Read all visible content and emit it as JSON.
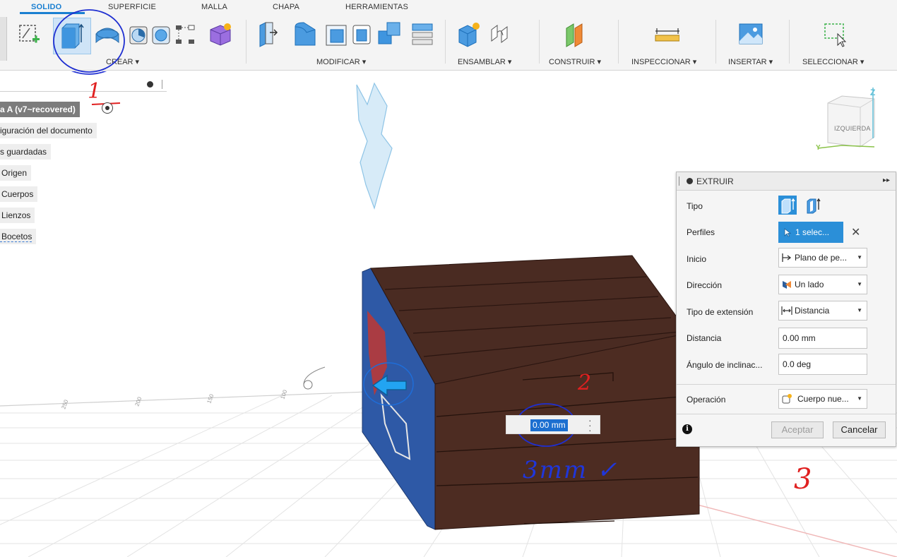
{
  "toolbar": {
    "tabs": [
      "SOLIDO",
      "SUPERFICIE",
      "MALLA",
      "CHAPA",
      "HERRAMIENTAS"
    ],
    "groups": {
      "crear": "CREAR ▾",
      "modificar": "MODIFICAR ▾",
      "ensamblar": "ENSAMBLAR ▾",
      "construir": "CONSTRUIR ▾",
      "inspeccionar": "INSPECCIONAR ▾",
      "insertar": "INSERTAR ▾",
      "seleccionar": "SELECCIONAR ▾"
    }
  },
  "browser": {
    "root": "a A (v7~recovered)",
    "items": [
      "iguración del documento",
      "s guardadas",
      "Origen",
      "Cuerpos",
      "Lienzos",
      "Bocetos"
    ]
  },
  "viewcube": {
    "face": "IZQUIERDA",
    "axis_z": "Z",
    "axis_y": "Y"
  },
  "extrude_panel": {
    "title": "EXTRUIR",
    "rows": {
      "tipo": "Tipo",
      "perfiles": "Perfiles",
      "inicio": "Inicio",
      "direccion": "Dirección",
      "tipo_extension": "Tipo de extensión",
      "distancia": "Distancia",
      "angulo": "Ángulo de inclinac...",
      "operacion": "Operación"
    },
    "values": {
      "perfiles": "1 selec...",
      "inicio": "Plano de pe...",
      "direccion": "Un lado",
      "tipo_extension": "Distancia",
      "distancia": "0.00 mm",
      "angulo": "0.0 deg",
      "operacion": "Cuerpo nue..."
    },
    "buttons": {
      "ok": "Aceptar",
      "cancel": "Cancelar"
    }
  },
  "canvas_input": {
    "value": "0.00 mm"
  },
  "annotations": {
    "one": "1",
    "two": "2",
    "three": "3",
    "note": "3mm ✓"
  },
  "colors": {
    "accent": "#2b8fd8",
    "annotation_red": "#e02020",
    "annotation_blue": "#2036d9"
  }
}
